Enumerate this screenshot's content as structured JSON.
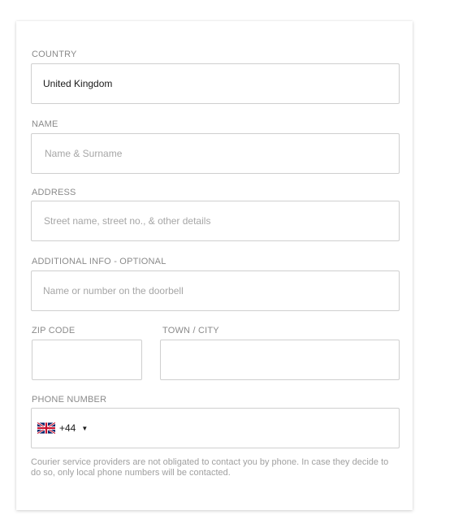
{
  "form": {
    "country": {
      "label": "COUNTRY",
      "value": "United Kingdom"
    },
    "name": {
      "label": "NAME",
      "placeholder": "Name & Surname"
    },
    "address": {
      "label": "ADDRESS",
      "placeholder": "Street name, street no., & other details"
    },
    "additional_info": {
      "label": "ADDITIONAL INFO - OPTIONAL",
      "placeholder": "Name or number on the doorbell"
    },
    "zip": {
      "label": "ZIP CODE",
      "placeholder": ""
    },
    "town": {
      "label": "TOWN / CITY",
      "placeholder": ""
    },
    "phone": {
      "label": "PHONE NUMBER",
      "flag_icon": "uk-flag-icon",
      "dial_code": "+44",
      "caret_icon": "caret-down-icon",
      "caret": "▼"
    },
    "note": "Courier service providers are not obligated to contact you by phone. In case they decide to do so, only local phone numbers will be contacted."
  }
}
